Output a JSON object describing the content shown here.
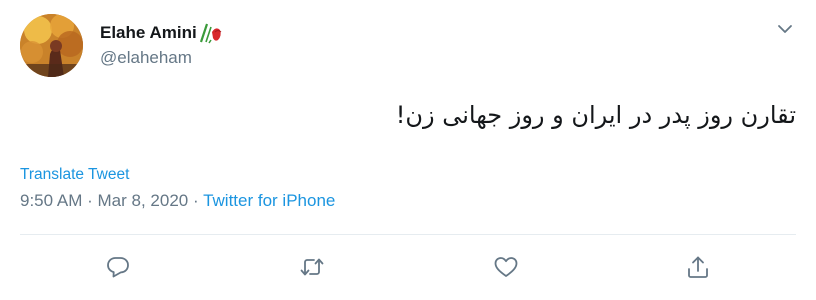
{
  "author": {
    "display_name": "Elahe Amini",
    "name_emoji": "flag-tulip-icon",
    "handle": "@elaheham",
    "avatar": "profile-photo"
  },
  "tweet": {
    "text": "تقارن روز پدر در ایران و روز جهانی زن!",
    "translate_label": "Translate Tweet",
    "time": "9:50 AM",
    "separator": "·",
    "date": "Mar 8, 2020",
    "source": "Twitter for iPhone"
  },
  "actions": [
    {
      "name": "reply",
      "icon": "reply-icon"
    },
    {
      "name": "retweet",
      "icon": "retweet-icon"
    },
    {
      "name": "like",
      "icon": "heart-icon"
    },
    {
      "name": "share",
      "icon": "share-icon"
    }
  ],
  "colors": {
    "link": "#1b95e0",
    "secondary_text": "#657786",
    "primary_text": "#14171a",
    "divider": "#e6ecf0"
  }
}
